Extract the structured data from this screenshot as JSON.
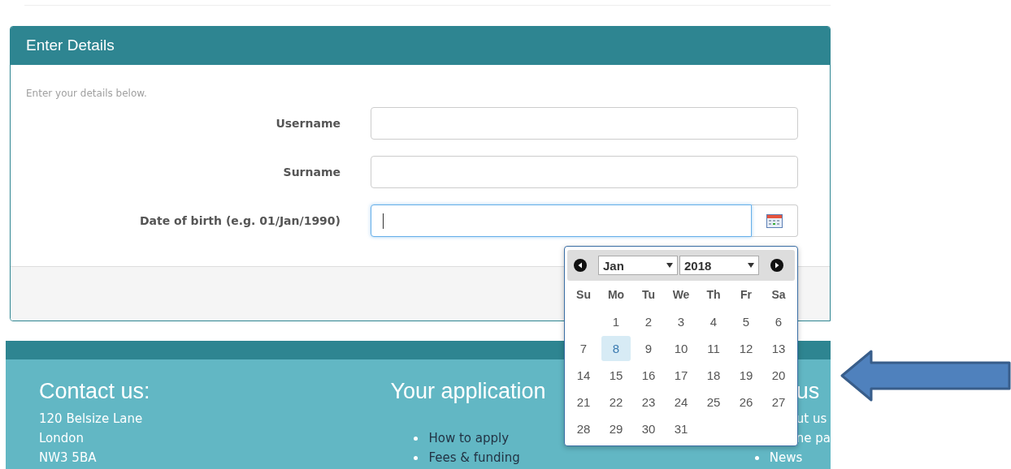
{
  "panel": {
    "title": "Enter Details",
    "hint": "Enter your details below.",
    "fields": [
      {
        "label": "Username",
        "kind": "text",
        "focused": false
      },
      {
        "label": "Surname",
        "kind": "text",
        "focused": false
      },
      {
        "label": "Date of birth (e.g. 01/Jan/1990)",
        "kind": "date",
        "focused": true
      }
    ]
  },
  "datepicker": {
    "month": "Jan",
    "year": "2018",
    "weekdays": [
      "Su",
      "Mo",
      "Tu",
      "We",
      "Th",
      "Fr",
      "Sa"
    ],
    "weeks": [
      [
        {
          "label": "1",
          "selected": false
        },
        {
          "label": "2",
          "selected": false
        },
        {
          "label": "3",
          "selected": false
        },
        {
          "label": "4",
          "selected": false
        },
        {
          "label": "5",
          "selected": false
        },
        {
          "label": "6",
          "selected": false
        }
      ],
      [
        {
          "label": "7",
          "selected": false
        },
        {
          "label": "8",
          "selected": true
        },
        {
          "label": "9",
          "selected": false
        },
        {
          "label": "10",
          "selected": false
        },
        {
          "label": "11",
          "selected": false
        },
        {
          "label": "12",
          "selected": false
        },
        {
          "label": "13",
          "selected": false
        }
      ],
      [
        {
          "label": "14",
          "selected": false
        },
        {
          "label": "15",
          "selected": false
        },
        {
          "label": "16",
          "selected": false
        },
        {
          "label": "17",
          "selected": false
        },
        {
          "label": "18",
          "selected": false
        },
        {
          "label": "19",
          "selected": false
        },
        {
          "label": "20",
          "selected": false
        }
      ],
      [
        {
          "label": "21",
          "selected": false
        },
        {
          "label": "22",
          "selected": false
        },
        {
          "label": "23",
          "selected": false
        },
        {
          "label": "24",
          "selected": false
        },
        {
          "label": "25",
          "selected": false
        },
        {
          "label": "26",
          "selected": false
        },
        {
          "label": "27",
          "selected": false
        }
      ],
      [
        {
          "label": "28",
          "selected": false
        },
        {
          "label": "29",
          "selected": false
        },
        {
          "label": "30",
          "selected": false
        },
        {
          "label": "31",
          "selected": false
        }
      ]
    ]
  },
  "footer": {
    "columns": [
      {
        "heading": "Contact us:",
        "kind": "address",
        "items": [
          {
            "label": "120 Belsize Lane",
            "bullet": false
          },
          {
            "label": "London",
            "bullet": false
          },
          {
            "label": "NW3 5BA",
            "bullet": false
          }
        ]
      },
      {
        "heading": "Your application",
        "kind": "links",
        "items": [
          {
            "label": "How to apply",
            "bullet": true
          },
          {
            "label": "Fees & funding",
            "bullet": true
          }
        ]
      },
      {
        "heading": "us",
        "kind": "links",
        "items": [
          {
            "label": "ut us",
            "bullet": false
          },
          {
            "label": "ne pa",
            "bullet": false
          },
          {
            "label": "News",
            "bullet": true
          }
        ]
      }
    ]
  }
}
